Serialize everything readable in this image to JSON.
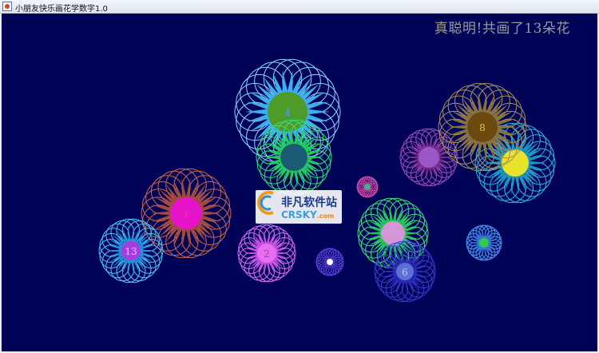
{
  "window": {
    "title": "小朋友快乐画花学数字1.0"
  },
  "status_text": "真聪明!共画了13朵花",
  "watermark": {
    "line1": "非凡软件站",
    "line2": "CRSKY",
    "line2_suffix": ".com"
  },
  "colors": {
    "canvas_background": "#010357",
    "status_text": "#9a9a9a"
  },
  "flowers": [
    {
      "label": "4",
      "petal_color": "#3ab0f0",
      "ring_color": "#8fd4ff",
      "center_color": "#4f9b2a",
      "label_color": "#4fa0ff"
    },
    {
      "label": "",
      "petal_color": "#21c95c",
      "ring_color": "#35e07a",
      "center_color": "#1b5a73",
      "label_color": "#ffffff"
    },
    {
      "label": "1",
      "petal_color": "#a04a3c",
      "ring_color": "#c8654e",
      "center_color": "#e514c8",
      "label_color": "#e53aa0"
    },
    {
      "label": "13",
      "petal_color": "#1f8fd6",
      "ring_color": "#4fc3ff",
      "center_color": "#a93ce0",
      "label_color": "#f0c0ff"
    },
    {
      "label": "2",
      "petal_color": "#c24de0",
      "ring_color": "#d96cf5",
      "center_color": "#e86ef0",
      "label_color": "#9a35d0"
    },
    {
      "label": "",
      "petal_color": "#3a2ab8",
      "ring_color": "#5540d8",
      "center_color": "#ffffff",
      "label_color": "#ffffff"
    },
    {
      "label": "",
      "petal_color": "#7a2c8c",
      "ring_color": "#a04ab8",
      "center_color": "#9a58c6",
      "label_color": "#ffffff"
    },
    {
      "label": "",
      "petal_color": "#22c45a",
      "ring_color": "#3ee07c",
      "center_color": "#d596d8",
      "label_color": "#ffffff"
    },
    {
      "label": "6",
      "petal_color": "#2a2ab0",
      "ring_color": "#3b3bd6",
      "center_color": "#5a6fd8",
      "label_color": "#c0c8f0"
    },
    {
      "label": "",
      "petal_color": "#3074d8",
      "ring_color": "#4a8ef0",
      "center_color": "#33c94a",
      "label_color": "#ffffff"
    },
    {
      "label": "",
      "petal_color": "#b02a8a",
      "ring_color": "#d04aa8",
      "center_color": "#3bb58a",
      "label_color": "#ffffff"
    },
    {
      "label": "",
      "petal_color": "#1a95c0",
      "ring_color": "#2ab8e0",
      "center_color": "#e8e22a",
      "label_color": "#ffffff"
    },
    {
      "label": "8",
      "petal_color": "#877240",
      "ring_color": "#a89058",
      "center_color": "#6b4a12",
      "label_color": "#e8c040"
    }
  ]
}
